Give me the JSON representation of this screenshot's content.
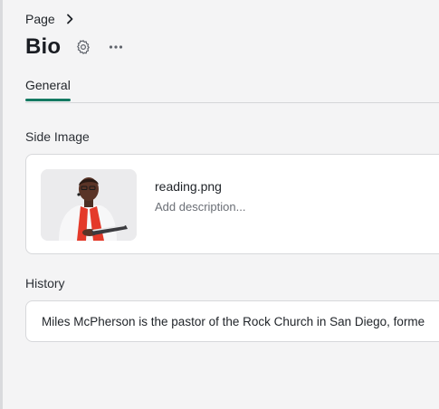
{
  "breadcrumb": {
    "label": "Page"
  },
  "header": {
    "title": "Bio"
  },
  "tabs": [
    {
      "label": "General",
      "active": true
    }
  ],
  "fields": {
    "side_image": {
      "label": "Side Image",
      "file_name": "reading.png",
      "description_placeholder": "Add description..."
    },
    "history": {
      "label": "History",
      "value": "Miles McPherson is the pastor of the Rock Church in San Diego, forme"
    }
  },
  "icons": {
    "breadcrumb_separator": "chevron-right-icon",
    "settings": "gear-icon",
    "more": "more-horizontal-icon"
  },
  "colors": {
    "accent": "#157a63",
    "background": "#f4f4f5",
    "card": "#ffffff"
  }
}
